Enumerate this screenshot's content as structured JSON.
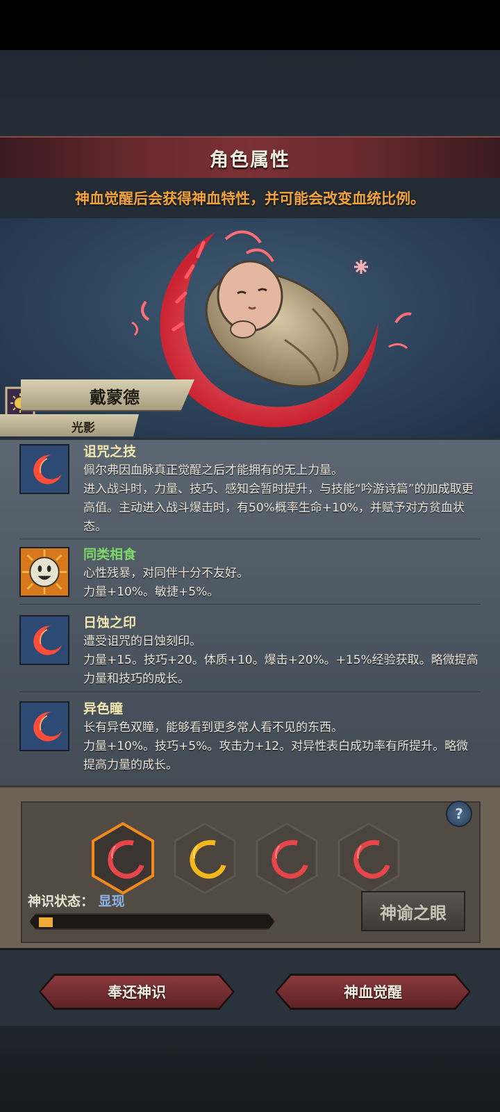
{
  "header": {
    "title": "角色属性"
  },
  "notice": "神血觉醒后会获得神血特性，并可能会改变血统比例。",
  "character": {
    "name": "戴蒙德",
    "subtitle": "光影"
  },
  "traits": [
    {
      "name": "诅咒之技",
      "name_color": "#f2e7b0",
      "icon": "red-crescent-icon",
      "desc": "佩尔弗因血脉真正觉醒之后才能拥有的无上力量。\n进入战斗时，力量、技巧、感知会暂时提升，与技能“吟游诗篇”的加成取更高值。主动进入战斗爆击时，有50%概率生命+10%，并赋予对方贫血状态。"
    },
    {
      "name": "同类相食",
      "name_color": "#7fd86a",
      "icon": "smiling-face-icon",
      "desc": "心性残暴，对同伴十分不友好。\n力量+10%。敏捷+5%。"
    },
    {
      "name": "日蚀之印",
      "name_color": "#f2e7b0",
      "icon": "red-crescent-icon",
      "desc": "遭受诅咒的日蚀刻印。\n力量+15。技巧+20。体质+10。爆击+20%。+15%经验获取。略微提高力量和技巧的成长。"
    },
    {
      "name": "异色瞳",
      "name_color": "#f2e7b0",
      "icon": "red-crescent-icon",
      "desc": "长有异色双瞳，能够看到更多常人看不见的东西。\n力量+10%。技巧+5%。攻击力+12。对异性表白成功率有所提升。略微提高力量的成长。"
    }
  ],
  "divine": {
    "slots": [
      {
        "icon": "red-crescent-icon",
        "selected": true,
        "color": "#e8454a"
      },
      {
        "icon": "gold-crescent-icon",
        "selected": false,
        "color": "#f2b81c"
      },
      {
        "icon": "red-crescent-icon",
        "selected": false,
        "color": "#e8454a"
      },
      {
        "icon": "red-crescent-icon",
        "selected": false,
        "color": "#e8454a"
      }
    ],
    "help_label": "?",
    "status_label": "神识状态：",
    "status_value": "显现",
    "progress": 0.06,
    "oracle_button": "神谕之眼"
  },
  "actions": {
    "return_label": "奉还神识",
    "awaken_label": "神血觉醒"
  },
  "colors": {
    "accent_orange": "#f2a43a",
    "title_red": "#7a3034",
    "status_blue": "#8ab3e6"
  }
}
